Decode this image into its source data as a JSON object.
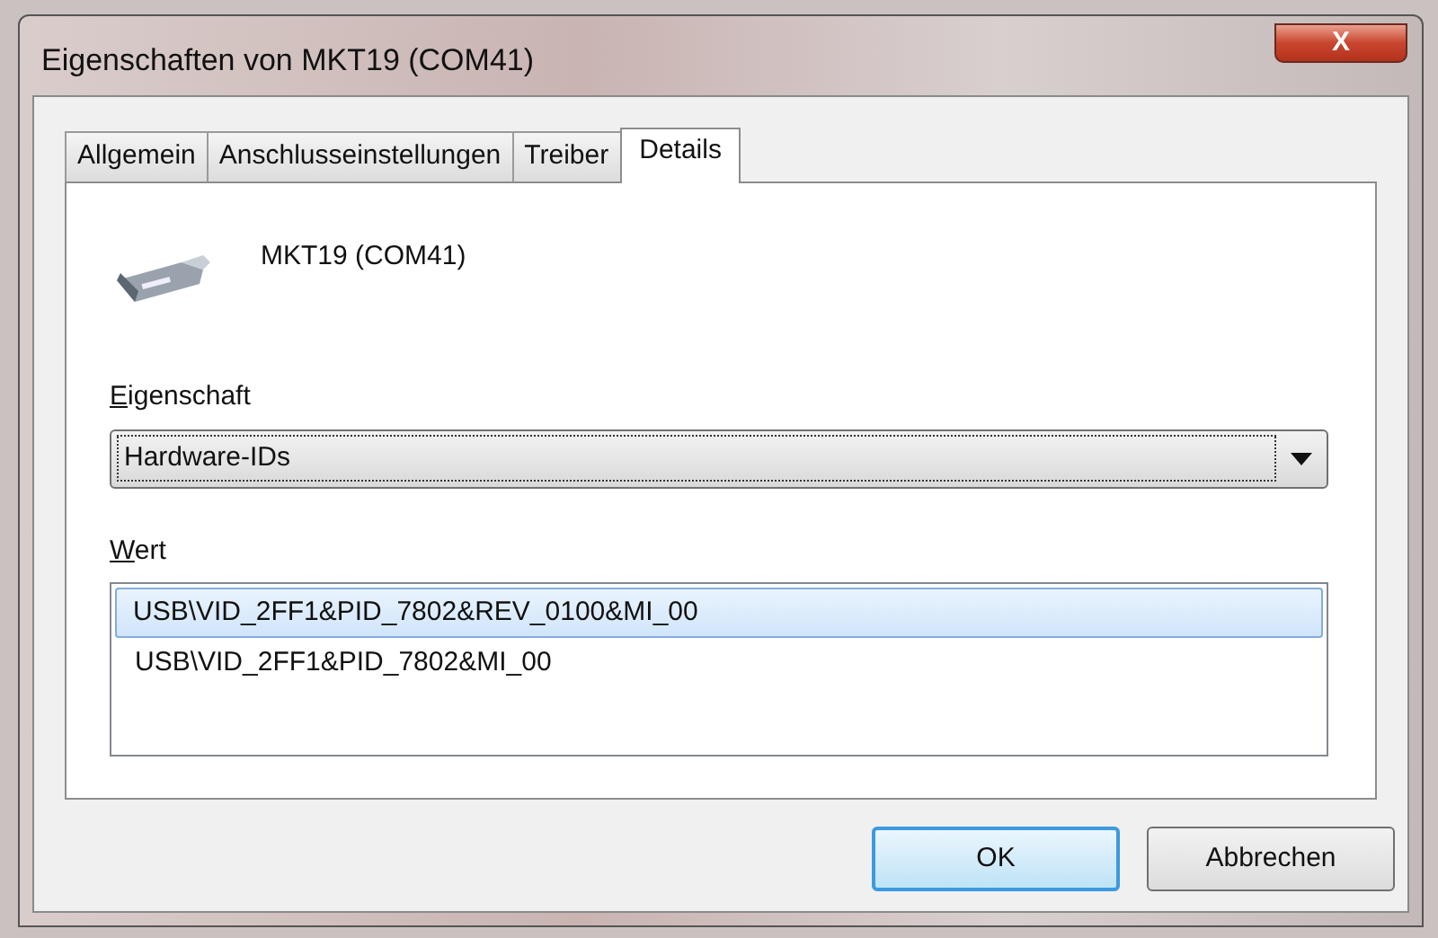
{
  "window": {
    "title": "Eigenschaften von MKT19 (COM41)",
    "close": "X"
  },
  "tabs": [
    {
      "label": "Allgemein",
      "selected": false
    },
    {
      "label": "Anschlusseinstellungen",
      "selected": false
    },
    {
      "label": "Treiber",
      "selected": false
    },
    {
      "label": "Details",
      "selected": true
    }
  ],
  "device": {
    "name": "MKT19 (COM41)"
  },
  "property": {
    "label": "Eigenschaft",
    "mnemonic_underlined": true,
    "value": "Hardware-IDs"
  },
  "values": {
    "label": "Wert",
    "mnemonic_underlined": true,
    "items": [
      {
        "text": "USB\\VID_2FF1&PID_7802&REV_0100&MI_00",
        "selected": true
      },
      {
        "text": "USB\\VID_2FF1&PID_7802&MI_00",
        "selected": false
      }
    ]
  },
  "buttons": [
    {
      "label": "OK",
      "default": true
    },
    {
      "label": "Abbrechen",
      "default": false
    }
  ]
}
